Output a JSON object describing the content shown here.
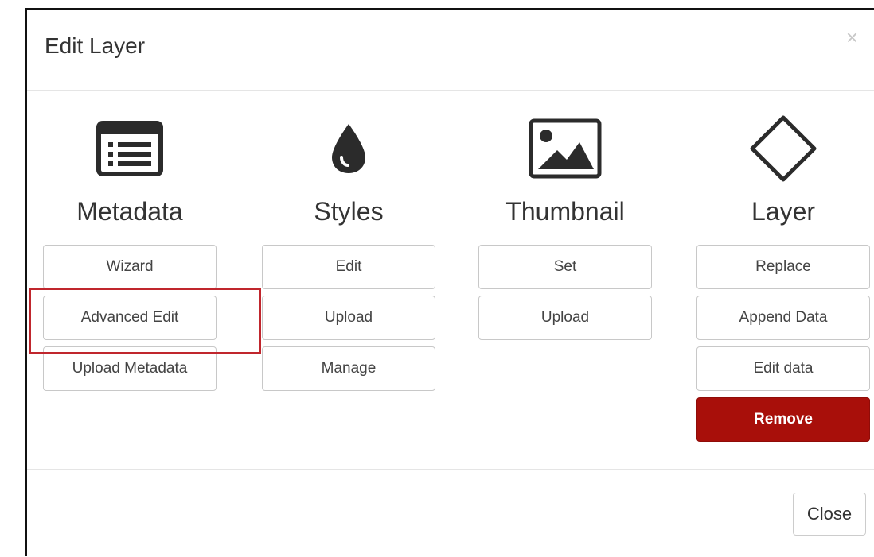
{
  "dialog": {
    "title": "Edit Layer",
    "close_icon_glyph": "×",
    "close_label": "Close"
  },
  "columns": [
    {
      "icon": "list-window-icon",
      "title": "Metadata",
      "buttons": [
        "Wizard",
        "Advanced Edit",
        "Upload Metadata"
      ]
    },
    {
      "icon": "droplet-icon",
      "title": "Styles",
      "buttons": [
        "Edit",
        "Upload",
        "Manage"
      ]
    },
    {
      "icon": "image-icon",
      "title": "Thumbnail",
      "buttons": [
        "Set",
        "Upload"
      ]
    },
    {
      "icon": "diamond-icon",
      "title": "Layer",
      "buttons": [
        "Replace",
        "Append Data",
        "Edit data"
      ],
      "danger_button": "Remove"
    }
  ],
  "colors": {
    "danger": "#a80f0a",
    "highlight": "#c0262d"
  }
}
